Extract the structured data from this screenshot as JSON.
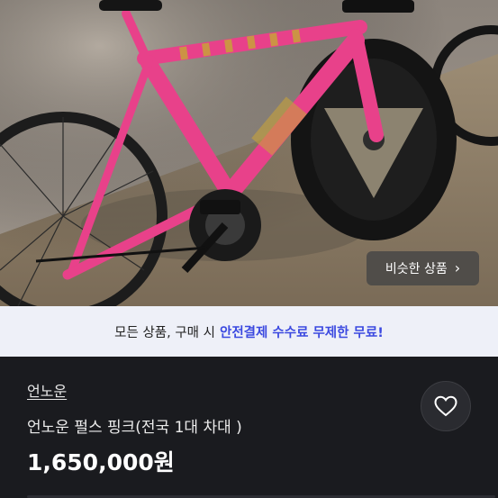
{
  "photo": {
    "icon": "bicycle-photo",
    "similar_button_label": "비슷한 상품",
    "similar_chevron": "›"
  },
  "promo": {
    "text_plain": "모든 상품, 구매 시",
    "text_highlight": "안전결제 수수료 무제한 무료!",
    "highlight_color": "#3b49e0"
  },
  "product": {
    "shop_name": "언노운",
    "title": "언노운 펄스 핑크(전국 1대 차대 )",
    "price": "1,650,000원",
    "like_icon": "heart-icon"
  }
}
